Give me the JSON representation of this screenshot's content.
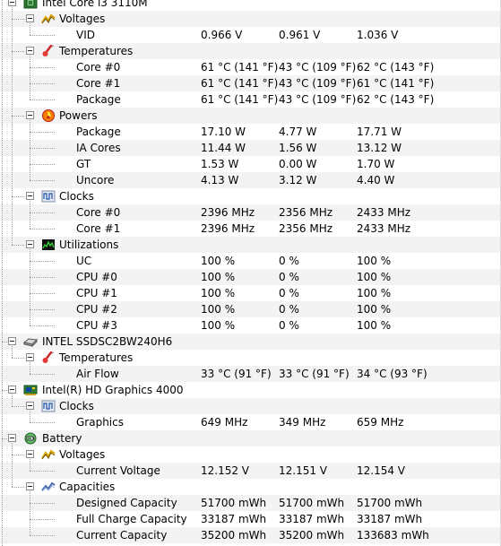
{
  "tree": [
    {
      "level": 0,
      "label": "Intel Core i3 3110M",
      "icon": "cpu-chip-icon"
    },
    {
      "level": 1,
      "label": "Voltages",
      "icon": "voltage-icon"
    },
    {
      "level": 2,
      "label": "VID",
      "min": "0.966 V",
      "val": "0.961 V",
      "max": "1.036 V"
    },
    {
      "level": 1,
      "label": "Temperatures",
      "icon": "thermometer-icon"
    },
    {
      "level": 2,
      "label": "Core #0",
      "min": "61 °C  (141 °F)",
      "val": "43 °C  (109 °F)",
      "max": "62 °C  (143 °F)"
    },
    {
      "level": 2,
      "label": "Core #1",
      "min": "61 °C  (141 °F)",
      "val": "43 °C  (109 °F)",
      "max": "61 °C  (141 °F)"
    },
    {
      "level": 2,
      "label": "Package",
      "min": "61 °C  (141 °F)",
      "val": "43 °C  (109 °F)",
      "max": "62 °C  (143 °F)"
    },
    {
      "level": 1,
      "label": "Powers",
      "icon": "power-flame-icon"
    },
    {
      "level": 2,
      "label": "Package",
      "min": "17.10 W",
      "val": "4.77 W",
      "max": "17.71 W"
    },
    {
      "level": 2,
      "label": "IA Cores",
      "min": "11.44 W",
      "val": "1.56 W",
      "max": "13.12 W"
    },
    {
      "level": 2,
      "label": "GT",
      "min": "1.53 W",
      "val": "0.00 W",
      "max": "1.70 W"
    },
    {
      "level": 2,
      "label": "Uncore",
      "min": "4.13 W",
      "val": "3.12 W",
      "max": "4.40 W"
    },
    {
      "level": 1,
      "label": "Clocks",
      "icon": "clock-wave-icon"
    },
    {
      "level": 2,
      "label": "Core #0",
      "min": "2396 MHz",
      "val": "2356 MHz",
      "max": "2433 MHz"
    },
    {
      "level": 2,
      "label": "Core #1",
      "min": "2396 MHz",
      "val": "2356 MHz",
      "max": "2433 MHz"
    },
    {
      "level": 1,
      "label": "Utilizations",
      "icon": "utilization-graph-icon"
    },
    {
      "level": 2,
      "label": "UC",
      "min": "100 %",
      "val": "0 %",
      "max": "100 %"
    },
    {
      "level": 2,
      "label": "CPU #0",
      "min": "100 %",
      "val": "0 %",
      "max": "100 %"
    },
    {
      "level": 2,
      "label": "CPU #1",
      "min": "100 %",
      "val": "0 %",
      "max": "100 %"
    },
    {
      "level": 2,
      "label": "CPU #2",
      "min": "100 %",
      "val": "0 %",
      "max": "100 %"
    },
    {
      "level": 2,
      "label": "CPU #3",
      "min": "100 %",
      "val": "0 %",
      "max": "100 %"
    },
    {
      "level": 0,
      "label": "INTEL SSDSC2BW240H6",
      "icon": "disk-drive-icon"
    },
    {
      "level": 1,
      "label": "Temperatures",
      "icon": "thermometer-icon"
    },
    {
      "level": 2,
      "label": "Air Flow",
      "min": "33 °C  (91 °F)",
      "val": "33 °C  (91 °F)",
      "max": "34 °C  (93 °F)"
    },
    {
      "level": 0,
      "label": "Intel(R) HD Graphics 4000",
      "icon": "graphics-card-icon"
    },
    {
      "level": 1,
      "label": "Clocks",
      "icon": "clock-wave-icon"
    },
    {
      "level": 2,
      "label": "Graphics",
      "min": "649 MHz",
      "val": "349 MHz",
      "max": "659 MHz"
    },
    {
      "level": 0,
      "label": "Battery",
      "icon": "battery-icon"
    },
    {
      "level": 1,
      "label": "Voltages",
      "icon": "voltage-icon"
    },
    {
      "level": 2,
      "label": "Current Voltage",
      "min": "12.152 V",
      "val": "12.151 V",
      "max": "12.154 V"
    },
    {
      "level": 1,
      "label": "Capacities",
      "icon": "capacity-icon"
    },
    {
      "level": 2,
      "label": "Designed Capacity",
      "min": "51700 mWh",
      "val": "51700 mWh",
      "max": "51700 mWh"
    },
    {
      "level": 2,
      "label": "Full Charge Capacity",
      "min": "33187 mWh",
      "val": "33187 mWh",
      "max": "33187 mWh"
    },
    {
      "level": 2,
      "label": "Current Capacity",
      "min": "35200 mWh",
      "val": "35200 mWh",
      "max": "133683 mWh"
    }
  ]
}
